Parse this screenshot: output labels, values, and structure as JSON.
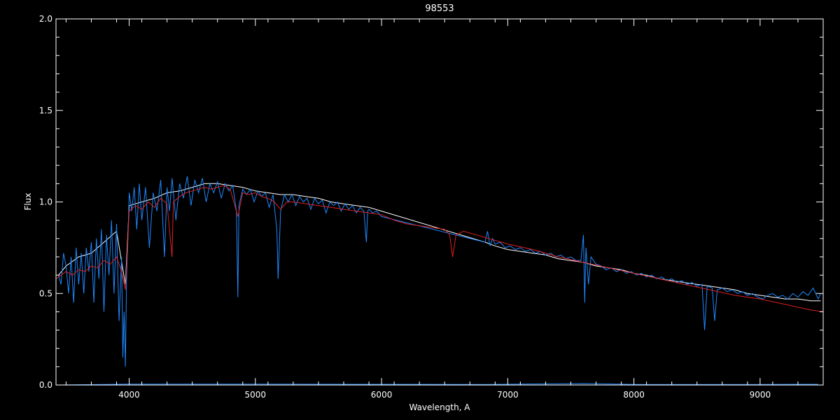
{
  "chart_data": {
    "type": "line",
    "title": "98553",
    "xlabel": "Wavelength, A",
    "ylabel": "Flux",
    "xlim": [
      3420,
      9500
    ],
    "ylim": [
      0.0,
      2.0
    ],
    "x_major_ticks": [
      4000,
      5000,
      6000,
      7000,
      8000,
      9000
    ],
    "x_tick_labels": [
      "4000",
      "5000",
      "6000",
      "7000",
      "8000",
      "9000"
    ],
    "y_major_ticks": [
      0.0,
      0.5,
      1.0,
      1.5,
      2.0
    ],
    "y_tick_labels": [
      "0.0",
      "0.5",
      "1.0",
      "1.5",
      "2.0"
    ],
    "grid": false,
    "background": "#000000",
    "series": [
      {
        "color": "#ffffff",
        "x": [
          3440,
          3500,
          3600,
          3700,
          3800,
          3900,
          3970,
          4000,
          4100,
          4200,
          4300,
          4400,
          4500,
          4600,
          4700,
          4800,
          4900,
          5000,
          5100,
          5200,
          5300,
          5400,
          5500,
          5600,
          5700,
          5800,
          5900,
          6000,
          6820,
          6900,
          7000,
          7100,
          7200,
          7300,
          7400,
          7500,
          7600,
          7700,
          7800,
          7900,
          8000,
          8100,
          8200,
          8300,
          8400,
          8500,
          8600,
          8700,
          8800,
          8900,
          9000,
          9100,
          9200,
          9300,
          9400,
          9480
        ],
        "y": [
          0.6,
          0.65,
          0.7,
          0.72,
          0.78,
          0.84,
          0.55,
          0.98,
          1.0,
          1.02,
          1.05,
          1.06,
          1.08,
          1.1,
          1.1,
          1.09,
          1.08,
          1.06,
          1.05,
          1.04,
          1.04,
          1.03,
          1.02,
          1.0,
          0.99,
          0.98,
          0.97,
          0.95,
          0.78,
          0.76,
          0.74,
          0.73,
          0.72,
          0.71,
          0.69,
          0.68,
          0.67,
          0.65,
          0.64,
          0.63,
          0.61,
          0.6,
          0.58,
          0.57,
          0.56,
          0.55,
          0.54,
          0.53,
          0.52,
          0.5,
          0.49,
          0.48,
          0.47,
          0.47,
          0.46,
          0.46
        ]
      },
      {
        "color": "#1e88ff",
        "x": [
          3440,
          3460,
          3480,
          3500,
          3520,
          3540,
          3560,
          3580,
          3600,
          3620,
          3640,
          3660,
          3680,
          3700,
          3720,
          3740,
          3760,
          3780,
          3800,
          3820,
          3840,
          3860,
          3880,
          3900,
          3920,
          3940,
          3950,
          3960,
          3970,
          3980,
          3990,
          4000,
          4020,
          4040,
          4060,
          4080,
          4100,
          4130,
          4160,
          4190,
          4220,
          4250,
          4280,
          4300,
          4320,
          4340,
          4370,
          4400,
          4430,
          4460,
          4490,
          4520,
          4550,
          4580,
          4610,
          4640,
          4670,
          4700,
          4730,
          4760,
          4790,
          4820,
          4850,
          4861,
          4870,
          4900,
          4930,
          4960,
          4990,
          5020,
          5050,
          5080,
          5110,
          5140,
          5170,
          5180,
          5200,
          5230,
          5260,
          5290,
          5320,
          5350,
          5380,
          5410,
          5440,
          5470,
          5500,
          5530,
          5560,
          5590,
          5620,
          5650,
          5680,
          5710,
          5740,
          5770,
          5800,
          5830,
          5860,
          5880,
          5890,
          5900,
          5930,
          5960,
          6000,
          6820,
          6840,
          6860,
          6880,
          6900,
          6940,
          6980,
          7020,
          7060,
          7100,
          7140,
          7180,
          7220,
          7260,
          7300,
          7340,
          7380,
          7420,
          7460,
          7500,
          7540,
          7580,
          7600,
          7610,
          7620,
          7640,
          7660,
          7700,
          7740,
          7780,
          7820,
          7860,
          7900,
          7940,
          7980,
          8020,
          8060,
          8100,
          8140,
          8180,
          8220,
          8260,
          8300,
          8340,
          8380,
          8420,
          8460,
          8500,
          8540,
          8560,
          8580,
          8620,
          8640,
          8660,
          8700,
          8740,
          8780,
          8820,
          8860,
          8900,
          8940,
          8980,
          9020,
          9060,
          9100,
          9140,
          9180,
          9220,
          9260,
          9300,
          9340,
          9380,
          9420,
          9460,
          9480
        ],
        "y": [
          0.6,
          0.55,
          0.72,
          0.65,
          0.5,
          0.7,
          0.45,
          0.75,
          0.55,
          0.72,
          0.5,
          0.75,
          0.62,
          0.78,
          0.45,
          0.8,
          0.58,
          0.85,
          0.4,
          0.82,
          0.6,
          0.9,
          0.5,
          0.88,
          0.35,
          0.7,
          0.15,
          0.4,
          0.1,
          0.6,
          0.8,
          1.05,
          0.95,
          1.08,
          0.85,
          1.1,
          0.9,
          1.08,
          0.75,
          1.05,
          0.95,
          1.12,
          0.7,
          1.08,
          0.95,
          1.13,
          0.9,
          1.1,
          1.02,
          1.14,
          0.98,
          1.12,
          1.05,
          1.13,
          1.0,
          1.1,
          1.05,
          1.11,
          1.02,
          1.1,
          1.06,
          1.09,
          0.95,
          0.48,
          0.98,
          1.07,
          1.04,
          1.07,
          1.0,
          1.06,
          1.03,
          1.05,
          0.97,
          1.04,
          0.85,
          0.58,
          0.95,
          1.04,
          1.0,
          1.04,
          0.98,
          1.03,
          1.0,
          1.02,
          0.96,
          1.02,
          0.99,
          1.01,
          0.94,
          1.0,
          0.98,
          1.0,
          0.95,
          0.99,
          0.96,
          0.98,
          0.94,
          0.97,
          0.95,
          0.78,
          0.95,
          0.96,
          0.94,
          0.95,
          0.92,
          0.78,
          0.84,
          0.76,
          0.8,
          0.77,
          0.78,
          0.75,
          0.76,
          0.74,
          0.75,
          0.73,
          0.74,
          0.72,
          0.73,
          0.71,
          0.72,
          0.7,
          0.71,
          0.69,
          0.7,
          0.68,
          0.68,
          0.82,
          0.45,
          0.75,
          0.55,
          0.7,
          0.66,
          0.65,
          0.63,
          0.64,
          0.62,
          0.63,
          0.61,
          0.62,
          0.6,
          0.61,
          0.59,
          0.6,
          0.58,
          0.59,
          0.57,
          0.58,
          0.56,
          0.57,
          0.55,
          0.56,
          0.54,
          0.55,
          0.3,
          0.54,
          0.53,
          0.35,
          0.52,
          0.53,
          0.51,
          0.52,
          0.5,
          0.51,
          0.49,
          0.5,
          0.48,
          0.47,
          0.49,
          0.5,
          0.48,
          0.49,
          0.47,
          0.5,
          0.48,
          0.51,
          0.49,
          0.53,
          0.47,
          0.5
        ]
      },
      {
        "color": "#e02020",
        "x": [
          3420,
          3460,
          3500,
          3550,
          3600,
          3650,
          3700,
          3750,
          3800,
          3850,
          3900,
          3940,
          3970,
          4000,
          4050,
          4100,
          4150,
          4200,
          4250,
          4300,
          4340,
          4350,
          4400,
          4450,
          4500,
          4550,
          4600,
          4650,
          4700,
          4750,
          4800,
          4861,
          4900,
          4950,
          5000,
          5050,
          5100,
          5150,
          5200,
          5250,
          5300,
          5400,
          5500,
          5600,
          5700,
          5800,
          5900,
          6000,
          6100,
          6200,
          6300,
          6400,
          6500,
          6540,
          6563,
          6590,
          6650,
          6800,
          7000,
          7200,
          7400,
          7600,
          7800,
          8000,
          8200,
          8400,
          8600,
          8800,
          9000,
          9200,
          9400,
          9500
        ],
        "y": [
          0.58,
          0.6,
          0.62,
          0.6,
          0.63,
          0.62,
          0.65,
          0.64,
          0.68,
          0.66,
          0.7,
          0.62,
          0.52,
          0.95,
          0.98,
          0.96,
          1.0,
          0.97,
          1.02,
          0.99,
          0.7,
          1.0,
          1.03,
          1.05,
          1.06,
          1.07,
          1.08,
          1.07,
          1.08,
          1.09,
          1.07,
          0.92,
          1.05,
          1.04,
          1.05,
          1.03,
          1.02,
          1.0,
          0.96,
          1.0,
          1.0,
          0.99,
          0.98,
          0.97,
          0.96,
          0.95,
          0.94,
          0.93,
          0.9,
          0.88,
          0.87,
          0.86,
          0.85,
          0.82,
          0.7,
          0.82,
          0.84,
          0.81,
          0.77,
          0.74,
          0.7,
          0.67,
          0.64,
          0.61,
          0.58,
          0.55,
          0.52,
          0.49,
          0.47,
          0.44,
          0.41,
          0.4
        ]
      },
      {
        "color": "#1e88ff",
        "x": [
          3440,
          4000,
          5000,
          6000,
          6820,
          7600,
          8000,
          9000,
          9460
        ],
        "y": [
          0.0,
          0.005,
          0.005,
          0.004,
          0.003,
          0.008,
          0.003,
          0.003,
          0.004
        ]
      }
    ]
  }
}
